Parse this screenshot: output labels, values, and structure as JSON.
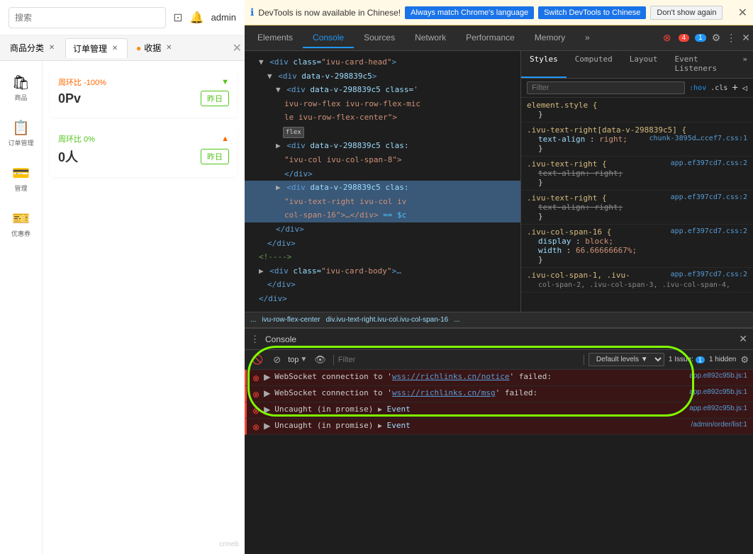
{
  "devtools_bar": {
    "info_text": "DevTools is now available in Chinese!",
    "btn_match_lang": "Always match Chrome's language",
    "btn_switch": "Switch DevTools to Chinese",
    "btn_dont_show": "Don't show again"
  },
  "app_header": {
    "search_placeholder": "搜索",
    "admin_label": "admin"
  },
  "tabs": [
    {
      "label": "商品分类",
      "active": false,
      "closable": true
    },
    {
      "label": "订单管理",
      "active": true,
      "closable": true
    },
    {
      "label": "收据",
      "active": false,
      "closable": true
    }
  ],
  "cards": [
    {
      "compare_label": "周环比 -100%",
      "value": "0Pv",
      "btn_label": "昨日"
    },
    {
      "compare_label": "周环比 0%",
      "value": "0人",
      "btn_label": "昨日"
    }
  ],
  "sidebar_items": [
    {
      "icon": "🛍",
      "label": "商品"
    },
    {
      "icon": "📋",
      "label": "订单管理"
    },
    {
      "icon": "💳",
      "label": "管理"
    },
    {
      "icon": "🎫",
      "label": "优惠券"
    }
  ],
  "devtools_tabs": {
    "items": [
      "Elements",
      "Console",
      "Sources",
      "Network",
      "Performance",
      "Memory"
    ],
    "active": "Elements",
    "more_label": "»",
    "error_count": "4",
    "msg_count": "1"
  },
  "styles_panel": {
    "tabs": [
      "Styles",
      "Computed",
      "Layout",
      "Event Listeners"
    ],
    "active_tab": "Styles",
    "more": "»",
    "filter_placeholder": "Filter",
    "filter_hov": ":hov",
    "filter_cls": ".cls",
    "rules": [
      {
        "selector": "element.style {",
        "source": "",
        "props": [
          {
            "name": "",
            "value": "}"
          }
        ]
      },
      {
        "selector": ".ivu-text-right[data-v-298839c5] {",
        "source": "chunk-3895d…ccef7.css:1",
        "props": [
          {
            "name": "text-align",
            "value": "right;",
            "strikethrough": false
          }
        ],
        "close": "}"
      },
      {
        "selector": ".ivu-text-right {",
        "source": "app.ef397cd7.css:2",
        "props": [
          {
            "name": "text-align",
            "value": "right;",
            "strikethrough": true
          }
        ],
        "close": "}"
      },
      {
        "selector": ".ivu-text-right {",
        "source": "app.ef397cd7.css:2",
        "props": [
          {
            "name": "text-align",
            "value": "right;",
            "strikethrough": true
          }
        ],
        "close": "}"
      },
      {
        "selector": ".ivu-col-span-16 {",
        "source": "app.ef397cd7.css:2",
        "props": [
          {
            "name": "display",
            "value": "block;",
            "strikethrough": false
          },
          {
            "name": "width",
            "value": "66.66666667%;",
            "strikethrough": false
          }
        ],
        "close": "}"
      },
      {
        "selector": ".ivu-col-span-1, .ivu-col-span-2, .ivu-col-span-3, .ivu-col-span-4,",
        "source": "app.ef397cd7.css:2",
        "props": [],
        "close": ""
      }
    ]
  },
  "html_tree": {
    "lines": [
      {
        "indent": 0,
        "content": "<div class=\"ivu-card-head\">",
        "type": "tag"
      },
      {
        "indent": 1,
        "content": "<div data-v-298839c5>",
        "type": "tag",
        "selected": false
      },
      {
        "indent": 2,
        "content": "<div data-v-298839c5 class='",
        "type": "tag"
      },
      {
        "indent": 3,
        "content": "ivu-row-flex ivu-row-flex-mid",
        "type": "text"
      },
      {
        "indent": 3,
        "content": "le ivu-row-flex-center\">",
        "type": "text"
      },
      {
        "indent": 4,
        "content": "flex",
        "type": "badge"
      },
      {
        "indent": 2,
        "content": "<div data-v-298839c5 clas:",
        "type": "tag"
      },
      {
        "indent": 3,
        "content": "\"ivu-col ivu-col-span-8\">",
        "type": "text"
      },
      {
        "indent": 3,
        "content": "</div>",
        "type": "close"
      },
      {
        "indent": 2,
        "content": "<div data-v-298839c5 clas:",
        "type": "tag",
        "selected": true
      },
      {
        "indent": 3,
        "content": "\"ivu-text-right ivu-col iv",
        "type": "text"
      },
      {
        "indent": 3,
        "content": "col-span-16\">…</div>  == $c",
        "type": "selected"
      },
      {
        "indent": 2,
        "content": "</div>",
        "type": "close"
      },
      {
        "indent": 1,
        "content": "</div>",
        "type": "close"
      },
      {
        "indent": 0,
        "content": "<!—->",
        "type": "comment"
      },
      {
        "indent": 0,
        "content": "<div class=\"ivu-card-body\">…",
        "type": "tag"
      },
      {
        "indent": 1,
        "content": "</div>",
        "type": "close"
      },
      {
        "indent": 0,
        "content": "</div>",
        "type": "close"
      }
    ]
  },
  "breadcrumb": {
    "items": [
      "...",
      "ivu-row-flex-center",
      "div.ivu-text-right.ivu-col.ivu-col-span-16",
      "..."
    ]
  },
  "console": {
    "title": "Console",
    "toolbar": {
      "filter_placeholder": "Filter",
      "levels_label": "Default levels ▼",
      "issue_label": "1 Issue:",
      "issue_count": "1",
      "hidden_label": "1 hidden"
    },
    "messages": [
      {
        "type": "error",
        "text": "WebSocket connection to '",
        "link": "wss://richlinks.cn/notice",
        "text2": "' failed:",
        "source": "app.e892c95b.js:1"
      },
      {
        "type": "error",
        "text": "WebSocket connection to '",
        "link": "wss://richlinks.cn/msg",
        "text2": "' failed:",
        "source": "app.e892c95b.js:1"
      },
      {
        "type": "error",
        "text": "Uncaught (in promise) ▶ Event",
        "link": "",
        "text2": "",
        "source": "app.e892c95b.js:1"
      },
      {
        "type": "error",
        "text": "Uncaught (in promise) ▶ Event",
        "link": "",
        "text2": "",
        "source": "/admin/order/list:1"
      }
    ]
  },
  "watermark": "crmeb"
}
